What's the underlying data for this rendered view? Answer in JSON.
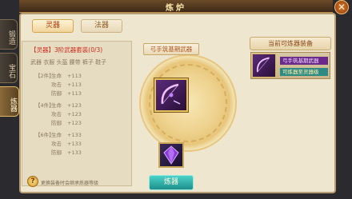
{
  "window": {
    "title": "炼炉"
  },
  "side_tabs": [
    "锻造",
    "宝石",
    "炼器"
  ],
  "tabs": {
    "active": "灵器",
    "inactive": "法器"
  },
  "set": {
    "title": "【灵器】3阶武器套装(0/3)",
    "parts": "武器 衣服 头盔 腰带 裤子 鞋子",
    "tiers": [
      {
        "label": "【2件】",
        "stats": [
          {
            "name": "生命",
            "value": "+113"
          },
          {
            "name": "攻击",
            "value": "+113"
          },
          {
            "name": "防御",
            "value": "+113"
          }
        ]
      },
      {
        "label": "【4件】",
        "stats": [
          {
            "name": "生命",
            "value": "+123"
          },
          {
            "name": "攻击",
            "value": "+123"
          },
          {
            "name": "防御",
            "value": "+123"
          }
        ]
      },
      {
        "label": "【6件】",
        "stats": [
          {
            "name": "生命",
            "value": "+133"
          },
          {
            "name": "攻击",
            "value": "+133"
          },
          {
            "name": "防御",
            "value": "+133"
          }
        ]
      }
    ]
  },
  "tip": {
    "icon": "question-icon",
    "text": "更换装备时会继承炼器等级"
  },
  "center": {
    "recommend": "弓手筑基期武器",
    "forge_button": "炼器"
  },
  "right": {
    "title": "当前可炼器装备",
    "item": {
      "name": "弓手筑基期武器",
      "status": "可炼器至灵器级"
    }
  },
  "colors": {
    "accent": "#d02a1a",
    "teal": "#1e8f8a",
    "gold": "#e6c25a"
  }
}
